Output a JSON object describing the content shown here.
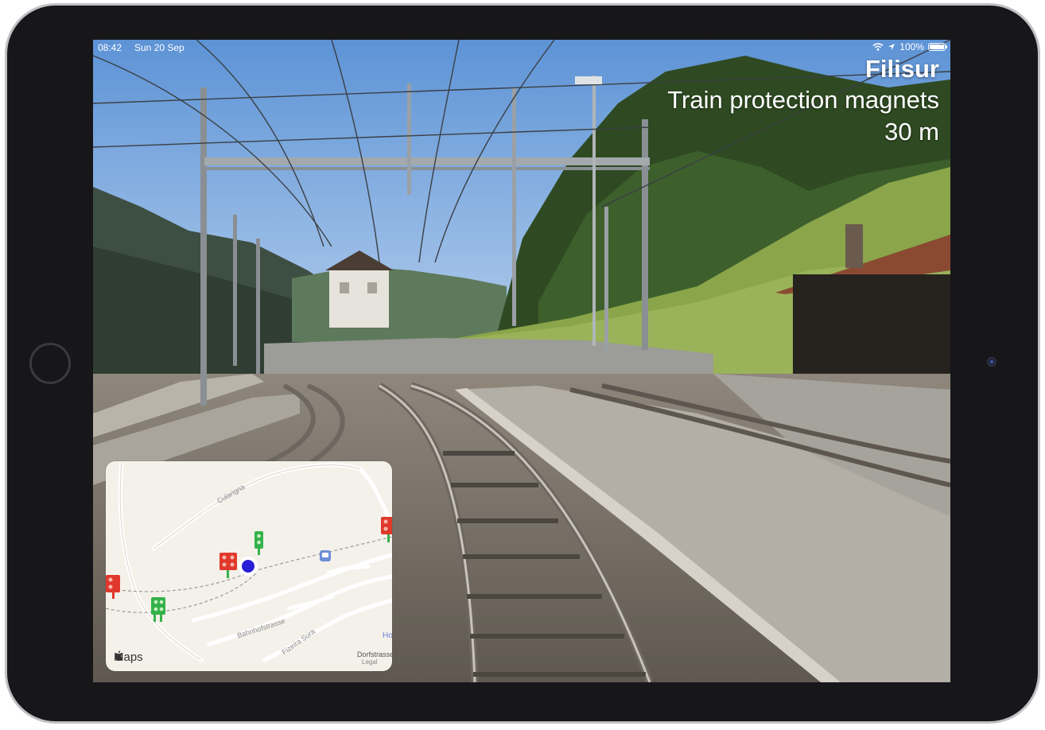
{
  "status_bar": {
    "time": "08:42",
    "date": "Sun 20 Sep",
    "battery": "100%",
    "icons": [
      "wifi-icon",
      "location-arrow-icon",
      "battery-icon"
    ]
  },
  "hud": {
    "station": "Filisur",
    "object": "Train protection magnets",
    "distance": "30 m"
  },
  "map": {
    "attribution": "Maps",
    "streets": [
      "Cularigna",
      "Bahnhofstrasse",
      "Fizeira Sura",
      "Dorfstrasse"
    ],
    "poi_partial": "Ho",
    "legal": "Legal",
    "colors": {
      "signal_red": "#e0392b",
      "signal_green": "#34b24a",
      "current_location": "#2a1fd6",
      "station_marker": "#6b8fd6"
    }
  }
}
